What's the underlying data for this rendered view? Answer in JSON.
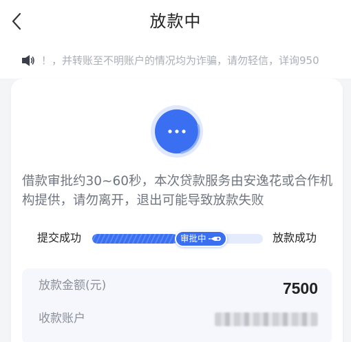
{
  "header": {
    "title": "放款中",
    "back_icon": "chevron-left-icon"
  },
  "notice": {
    "icon": "speaker-icon",
    "text": "！，并转账至不明账户的情况均为诈骗，请勿轻信，详询950"
  },
  "status": {
    "icon": "more-dots-icon",
    "accent": "#3a6ff2"
  },
  "description": "借款审批约30~60秒，本次贷款服务由安逸花或合作机构提供，请勿离开，退出可能导致放款失败",
  "progress": {
    "start_label": "提交成功",
    "current_label": "审批中",
    "end_label": "放款成功",
    "fraction": 0.5
  },
  "info": {
    "amount_label": "放款金额(元)",
    "amount_value": "7500",
    "account_label": "收款账户"
  }
}
